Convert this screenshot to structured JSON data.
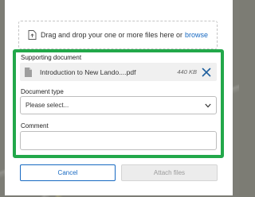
{
  "dropzone": {
    "text": "Drag and drop your one or more files here or",
    "browse_label": "browse",
    "icon": "upload-file-icon"
  },
  "supporting_document": {
    "label": "Supporting document",
    "file_name": "Introduction to New Lando....pdf",
    "file_size": "440 KB",
    "file_icon": "document-icon",
    "remove_icon": "close-icon"
  },
  "document_type": {
    "label": "Document type",
    "selected": "Please select...",
    "icon": "chevron-down-icon"
  },
  "comment": {
    "label": "Comment",
    "value": ""
  },
  "actions": {
    "cancel_label": "Cancel",
    "attach_label": "Attach files"
  },
  "colors": {
    "highlight": "#22a84a",
    "link": "#1769c2",
    "disabled_text": "#9b9b9b"
  }
}
